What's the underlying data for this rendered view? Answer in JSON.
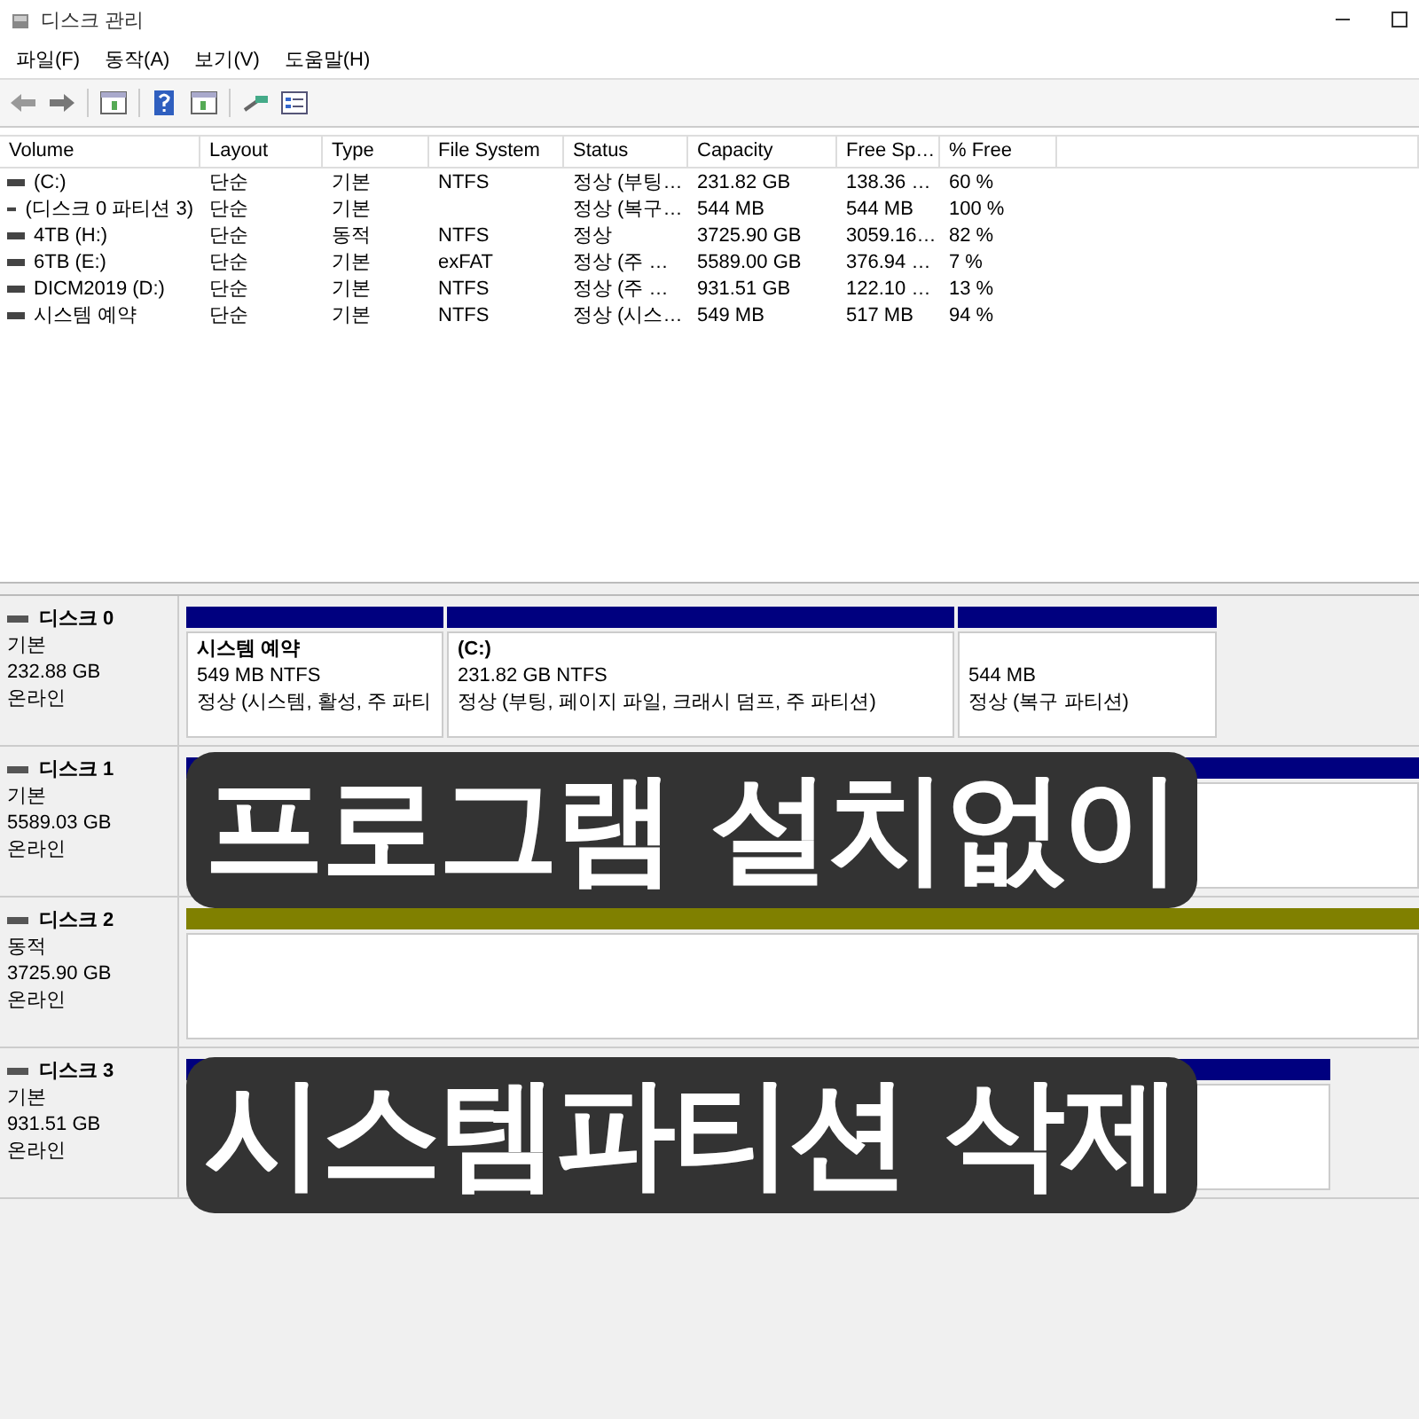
{
  "window": {
    "title": "디스크 관리"
  },
  "menu": [
    "파일(F)",
    "동작(A)",
    "보기(V)",
    "도움말(H)"
  ],
  "volumes_table": {
    "columns": [
      "Volume",
      "Layout",
      "Type",
      "File System",
      "Status",
      "Capacity",
      "Free Sp…",
      "% Free"
    ],
    "rows": [
      [
        "(C:)",
        "단순",
        "기본",
        "NTFS",
        "정상 (부팅…",
        "231.82 GB",
        "138.36 …",
        "60 %"
      ],
      [
        "(디스크 0 파티션 3)",
        "단순",
        "기본",
        "",
        "정상 (복구…",
        "544 MB",
        "544 MB",
        "100 %"
      ],
      [
        "4TB (H:)",
        "단순",
        "동적",
        "NTFS",
        "정상",
        "3725.90 GB",
        "3059.16…",
        "82 %"
      ],
      [
        "6TB (E:)",
        "단순",
        "기본",
        "exFAT",
        "정상 (주 …",
        "5589.00 GB",
        "376.94 …",
        "7 %"
      ],
      [
        "DICM2019 (D:)",
        "단순",
        "기본",
        "NTFS",
        "정상 (주 …",
        "931.51 GB",
        "122.10 …",
        "13 %"
      ],
      [
        "시스템 예약",
        "단순",
        "기본",
        "NTFS",
        "정상 (시스…",
        "549 MB",
        "517 MB",
        "94 %"
      ]
    ]
  },
  "disks": [
    {
      "name": "디스크 0",
      "type": "기본",
      "size": "232.88 GB",
      "status": "온라인",
      "partitions": [
        {
          "kind": "basic",
          "name": "시스템 예약",
          "size": "549 MB NTFS",
          "status": "정상 (시스템, 활성, 주 파티"
        },
        {
          "kind": "basic",
          "name": "(C:)",
          "size": "231.82 GB NTFS",
          "status": "정상 (부팅, 페이지 파일, 크래시 덤프, 주 파티션)"
        },
        {
          "kind": "basic",
          "size": "544 MB",
          "status": "정상 (복구 파티션)"
        }
      ]
    },
    {
      "name": "디스크 1",
      "type": "기본",
      "size": "5589.03 GB",
      "status": "온라인",
      "partitions": [
        {
          "kind": "basic"
        }
      ]
    },
    {
      "name": "디스크 2",
      "type": "동적",
      "size": "3725.90 GB",
      "status": "온라인",
      "partitions": [
        {
          "kind": "dynamic"
        }
      ]
    },
    {
      "name": "디스크 3",
      "type": "기본",
      "size": "931.51 GB",
      "status": "온라인",
      "partitions": [
        {
          "kind": "basic"
        }
      ]
    }
  ],
  "caption": {
    "lines": [
      "프로그램 설치없이",
      "시스템파티션 삭제"
    ]
  }
}
